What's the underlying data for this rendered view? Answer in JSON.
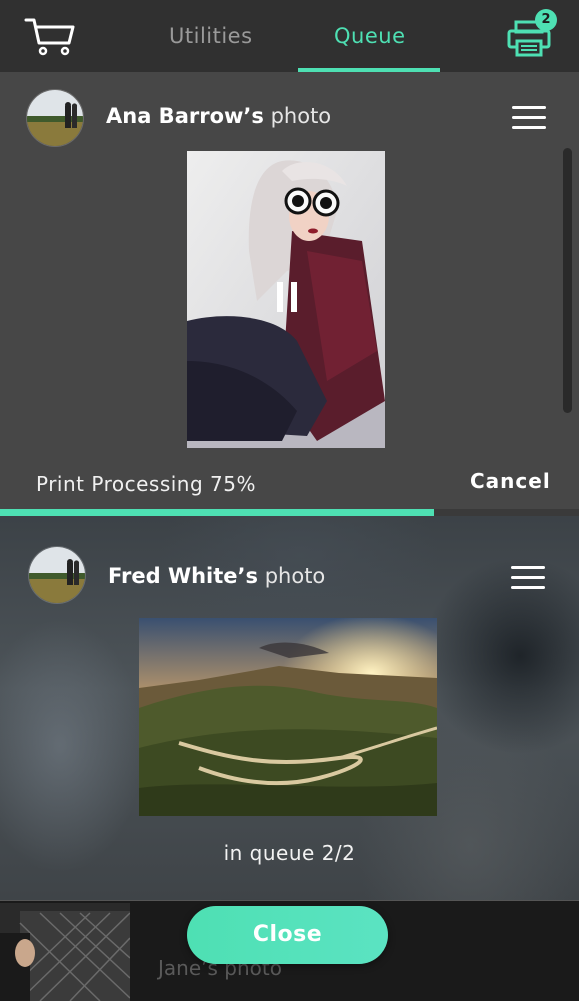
{
  "header": {
    "tabs": [
      {
        "label": "Utilities",
        "active": false
      },
      {
        "label": "Queue",
        "active": true
      }
    ],
    "printer_badge": "2",
    "accent_color": "#4ee0b3"
  },
  "queue": [
    {
      "owner_name": "Ana Barrow’s",
      "owner_suffix": "photo",
      "status": "Print Processing 75%",
      "progress": 0.75,
      "action_label": "Cancel"
    },
    {
      "owner_name": "Fred White’s",
      "owner_suffix": "photo",
      "status": "in queue 2/2"
    },
    {
      "owner_name": "Jane’s photo"
    }
  ],
  "footer": {
    "close_label": "Close"
  }
}
